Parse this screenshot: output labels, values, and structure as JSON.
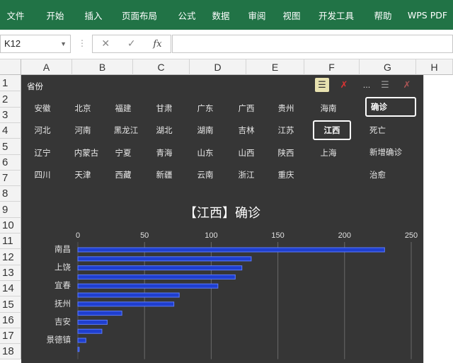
{
  "ribbon": {
    "tabs": [
      "文件",
      "开始",
      "插入",
      "页面布局",
      "公式",
      "数据",
      "审阅",
      "视图",
      "开发工具",
      "帮助",
      "WPS PDF"
    ],
    "bg": "#217346"
  },
  "formula_bar": {
    "name_box": "K12",
    "cancel_glyph": "✕",
    "enter_glyph": "✓",
    "fx_glyph": "fx",
    "value": ""
  },
  "grid": {
    "columns": [
      "A",
      "B",
      "C",
      "D",
      "E",
      "F",
      "G",
      "H"
    ],
    "rows": [
      "1",
      "2",
      "3",
      "4",
      "5",
      "6",
      "7",
      "8",
      "9",
      "10",
      "11",
      "12",
      "13",
      "14",
      "15",
      "16",
      "17",
      "18"
    ]
  },
  "slicer_province": {
    "title": "省份",
    "items": [
      "安徽",
      "北京",
      "福建",
      "甘肃",
      "广东",
      "广西",
      "贵州",
      "海南",
      "河北",
      "河南",
      "黑龙江",
      "湖北",
      "湖南",
      "吉林",
      "江苏",
      "江西",
      "辽宁",
      "内蒙古",
      "宁夏",
      "青海",
      "山东",
      "山西",
      "陕西",
      "上海",
      "四川",
      "天津",
      "西藏",
      "新疆",
      "云南",
      "浙江",
      "重庆"
    ],
    "selected": "江西"
  },
  "slicer_metric": {
    "more_glyph": "...",
    "items": [
      "确诊",
      "死亡",
      "新增确诊",
      "治愈"
    ],
    "selected": "确诊"
  },
  "chart_data": {
    "type": "bar",
    "orientation": "horizontal",
    "title": "【江西】确诊",
    "xlim": [
      0,
      250
    ],
    "xticks": [
      "0",
      "50",
      "100",
      "150",
      "200",
      "250"
    ],
    "categories": [
      "南昌",
      "",
      "上饶",
      "",
      "宜春",
      "",
      "抚州",
      "",
      "吉安",
      "",
      "景德镇",
      ""
    ],
    "values": [
      230,
      130,
      123,
      118,
      105,
      76,
      72,
      33,
      22,
      18,
      6,
      1
    ],
    "grid": true,
    "bar_color": "#1f3fcf",
    "bar_outline": "#5b7bff"
  }
}
